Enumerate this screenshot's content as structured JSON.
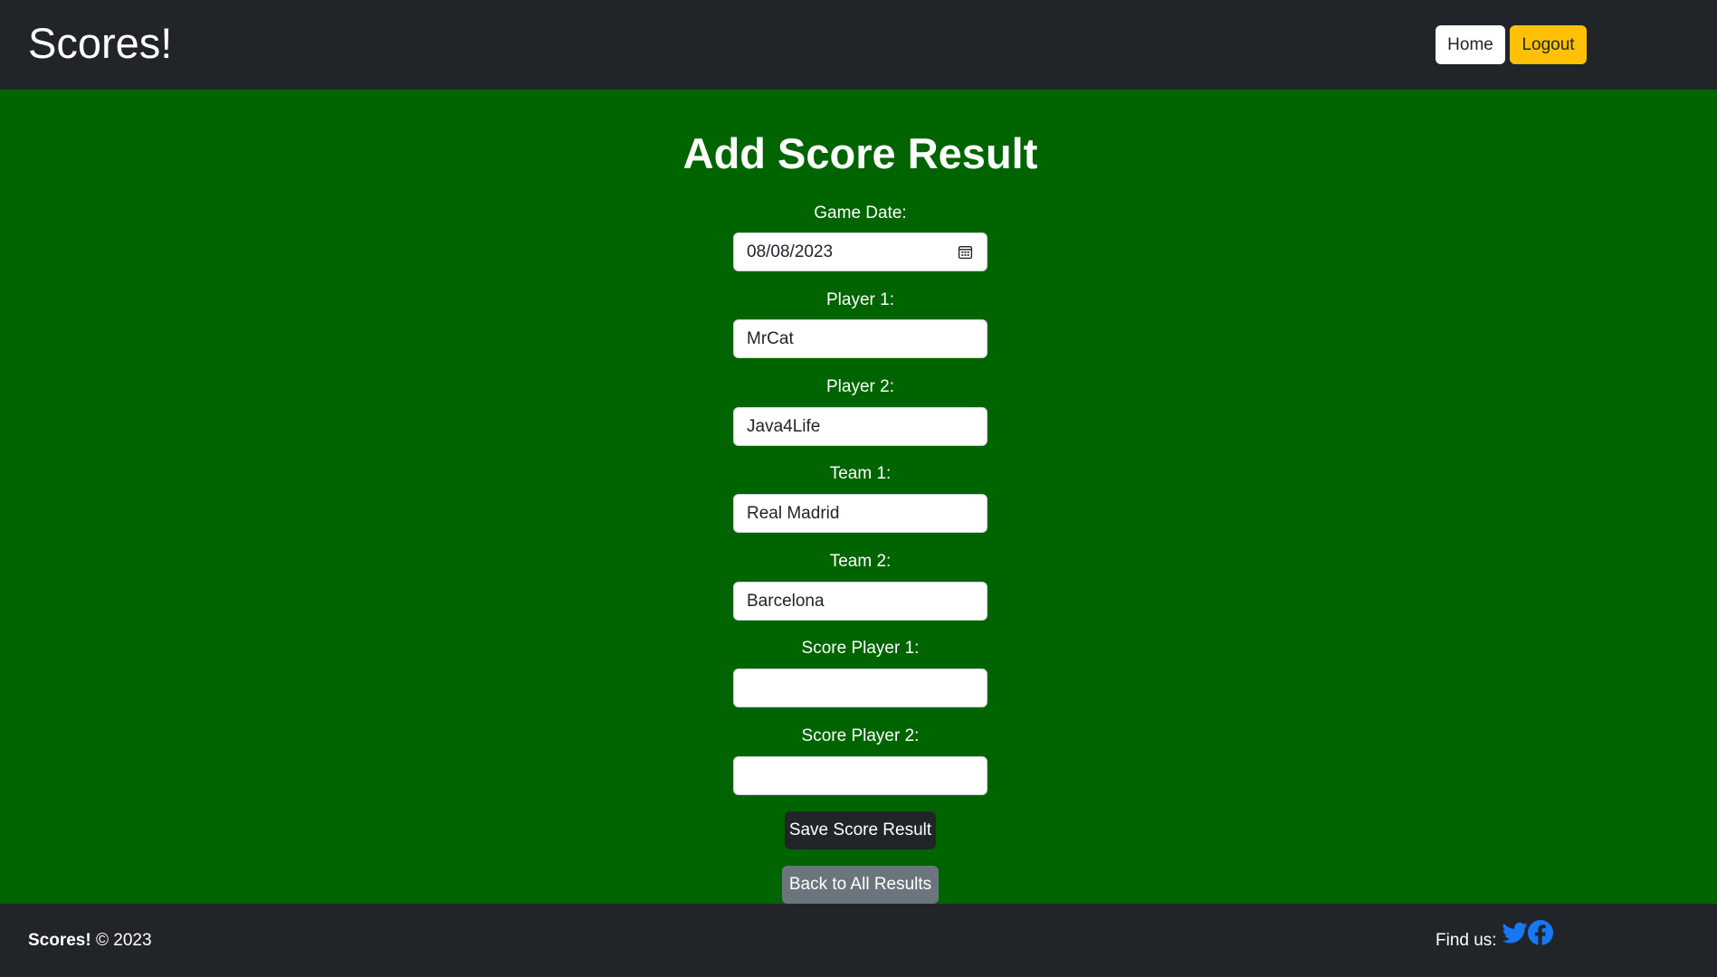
{
  "nav": {
    "brand": "Scores!",
    "home_label": "Home",
    "logout_label": "Logout"
  },
  "page_title": "Add Score Result",
  "form": {
    "game_date": {
      "label": "Game Date:",
      "value": "08/08/2023"
    },
    "player1": {
      "label": "Player 1:",
      "value": "MrCat"
    },
    "player2": {
      "label": "Player 2:",
      "value": "Java4Life"
    },
    "team1": {
      "label": "Team 1:",
      "value": "Real Madrid"
    },
    "team2": {
      "label": "Team 2:",
      "value": "Barcelona"
    },
    "score_player1": {
      "label": "Score Player 1:",
      "value": ""
    },
    "score_player2": {
      "label": "Score Player 2:",
      "value": ""
    },
    "save_label": "Save Score Result",
    "back_label": "Back to All Results"
  },
  "footer": {
    "brand": "Scores!",
    "copyright": "© 2023",
    "find_us": "Find us:",
    "icons": [
      "twitter-icon",
      "facebook-icon"
    ]
  },
  "colors": {
    "page_bg": "#006400",
    "navbar_bg": "#212529",
    "logout_accent": "#ffc107",
    "back_button": "#6c757d",
    "social_icon": "#1877f2"
  }
}
